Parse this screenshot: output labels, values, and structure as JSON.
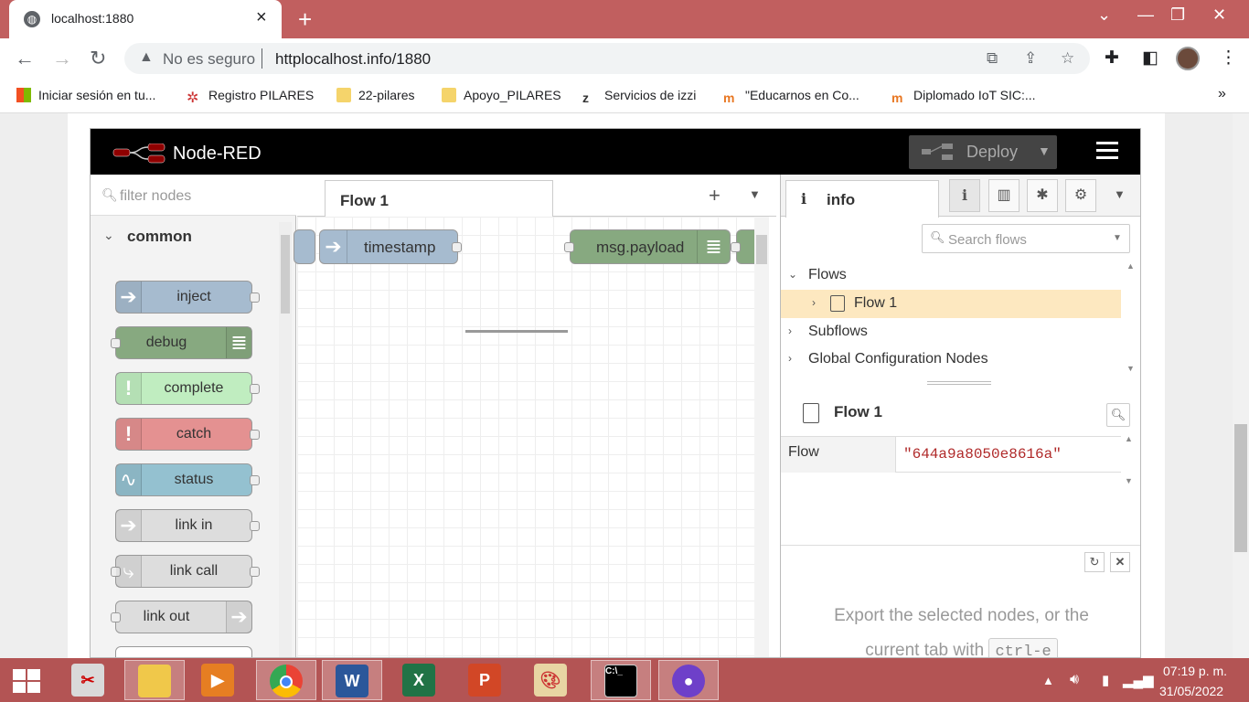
{
  "browser": {
    "tab_title": "localhost:1880",
    "security_label": "No es seguro",
    "url": "httplocalhost.info/1880",
    "bookmarks": [
      {
        "label": "Iniciar sesión en tu..."
      },
      {
        "label": "Registro PILARES"
      },
      {
        "label": "22-pilares"
      },
      {
        "label": "Apoyo_PILARES"
      },
      {
        "label": "Servicios de izzi"
      },
      {
        "label": "\"Educarnos en  Co..."
      },
      {
        "label": "Diplomado IoT SIC:..."
      }
    ],
    "more_bookmarks": "»"
  },
  "nodered": {
    "title": "Node-RED",
    "deploy_label": "Deploy",
    "palette": {
      "filter_placeholder": "filter nodes",
      "category": "common",
      "nodes": [
        {
          "label": "inject",
          "color": "#a6bbcf"
        },
        {
          "label": "debug",
          "color": "#87a980"
        },
        {
          "label": "complete",
          "color": "#c0edc0"
        },
        {
          "label": "catch",
          "color": "#e49191"
        },
        {
          "label": "status",
          "color": "#94c1d0"
        },
        {
          "label": "link in",
          "color": "#dddddd"
        },
        {
          "label": "link call",
          "color": "#dddddd"
        },
        {
          "label": "link out",
          "color": "#dddddd"
        }
      ]
    },
    "workspace": {
      "tab_label": "Flow 1",
      "nodes": [
        {
          "label": "timestamp",
          "color": "#a6bbcf"
        },
        {
          "label": "msg.payload",
          "color": "#87a980"
        }
      ]
    },
    "sidebar": {
      "tab_label": "info",
      "search_placeholder": "Search flows",
      "tree": {
        "flows": "Flows",
        "flow1": "Flow 1",
        "subflows": "Subflows",
        "global_config": "Global Configuration Nodes"
      },
      "props_title": "Flow 1",
      "prop_key": "Flow",
      "prop_value": "\"644a9a8050e8616a\"",
      "help_text": "Export the selected nodes, or the current tab with",
      "help_kbd": "ctrl-e"
    }
  },
  "taskbar": {
    "time": "07:19 p. m.",
    "date": "31/05/2022"
  }
}
